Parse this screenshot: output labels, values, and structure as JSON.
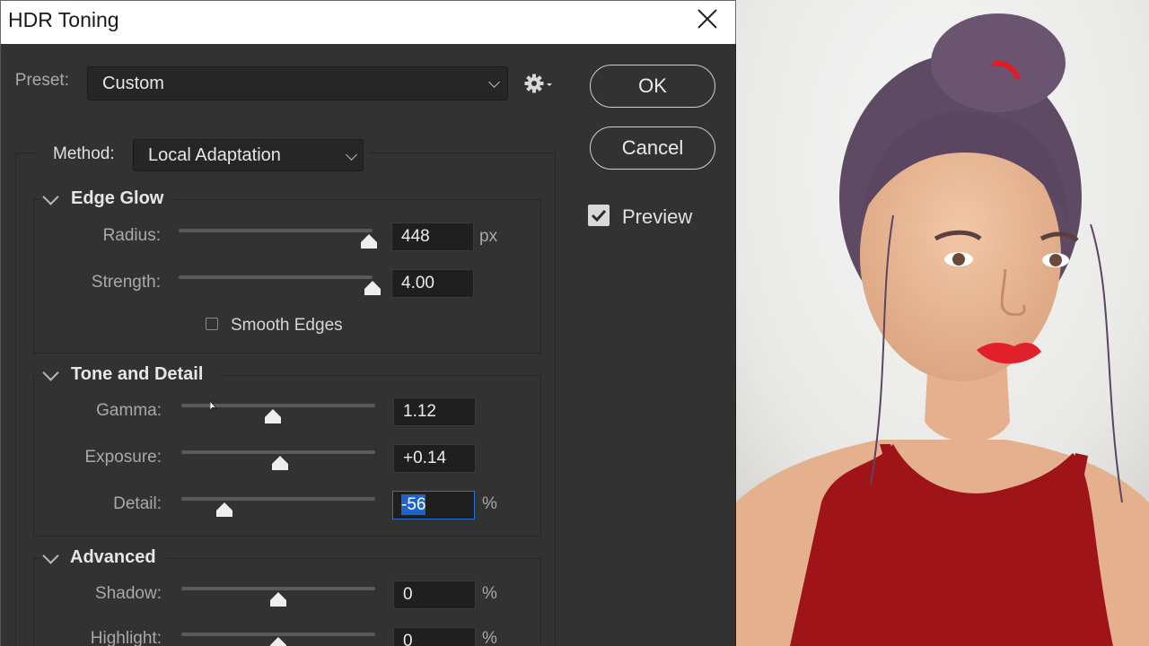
{
  "dialog": {
    "title": "HDR Toning",
    "preset_label": "Preset:",
    "preset_value": "Custom",
    "method_label": "Method:",
    "method_value": "Local Adaptation",
    "ok_label": "OK",
    "cancel_label": "Cancel",
    "preview_label": "Preview",
    "preview_checked": true
  },
  "edge_glow": {
    "title": "Edge Glow",
    "radius_label": "Radius:",
    "radius_value": "448",
    "radius_unit": "px",
    "radius_level": 0.98,
    "strength_label": "Strength:",
    "strength_value": "4.00",
    "strength_level": 1.0,
    "smooth_edges_label": "Smooth Edges",
    "smooth_edges_checked": false
  },
  "tone_and_detail": {
    "title": "Tone and Detail",
    "gamma_label": "Gamma:",
    "gamma_value": "1.12",
    "gamma_level": 0.47,
    "exposure_label": "Exposure:",
    "exposure_value": "+0.14",
    "exposure_level": 0.51,
    "detail_label": "Detail:",
    "detail_value": "-56",
    "detail_unit": "%",
    "detail_level": 0.22
  },
  "advanced": {
    "title": "Advanced",
    "shadow_label": "Shadow:",
    "shadow_value": "0",
    "shadow_unit": "%",
    "shadow_level": 0.5,
    "highlight_label": "Highlight:",
    "highlight_value": "0",
    "highlight_unit": "%",
    "highlight_level": 0.5
  },
  "colors": {
    "dialog_bg": "#323232",
    "field_bg": "#1f1f1f",
    "focus_border": "#2d6fd6",
    "selection_bg": "#1e63c9"
  },
  "icons": {
    "gear": "gear-icon",
    "close": "close-icon",
    "checkmark": "checkmark-icon"
  }
}
